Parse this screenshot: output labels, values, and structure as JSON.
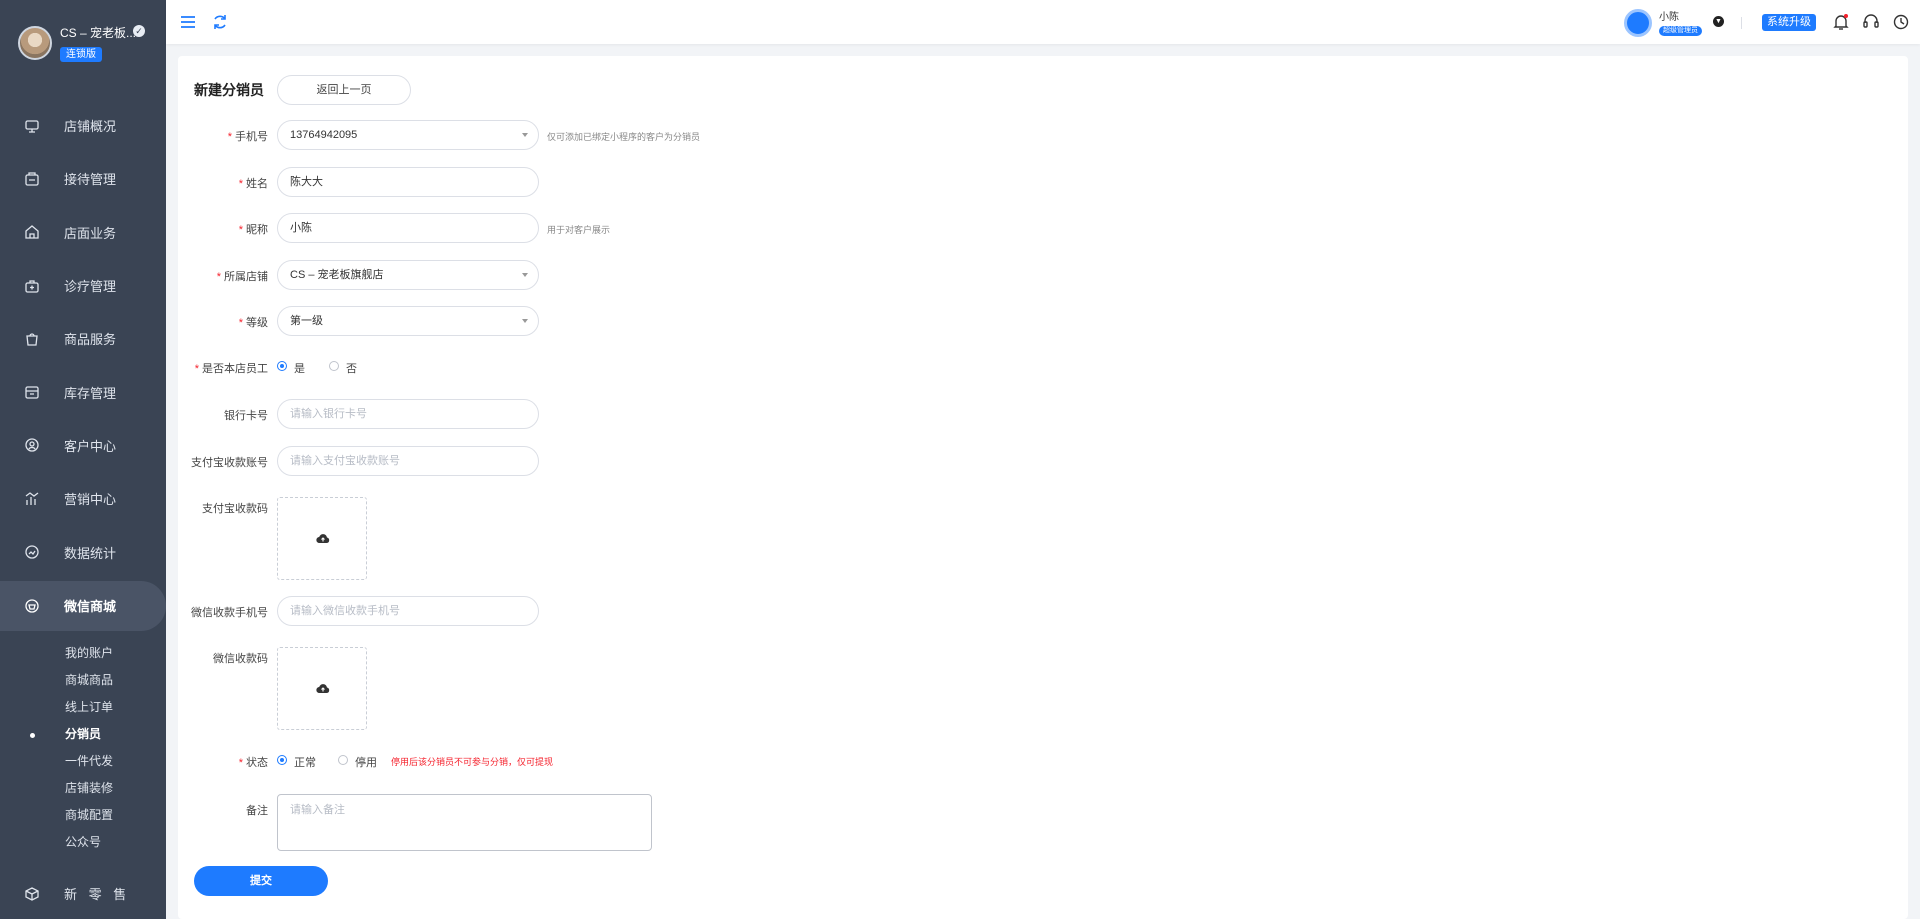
{
  "sidebar": {
    "shop_name": "CS – 宠老板...",
    "edition_badge": "连锁版",
    "menu": [
      {
        "label": "店铺概况",
        "icon": "monitor-icon"
      },
      {
        "label": "接待管理",
        "icon": "reception-icon"
      },
      {
        "label": "店面业务",
        "icon": "storefront-icon"
      },
      {
        "label": "诊疗管理",
        "icon": "medical-kit-icon"
      },
      {
        "label": "商品服务",
        "icon": "shopping-bag-icon"
      },
      {
        "label": "库存管理",
        "icon": "inventory-icon"
      },
      {
        "label": "客户中心",
        "icon": "customer-icon"
      },
      {
        "label": "营销中心",
        "icon": "marketing-chart-icon"
      },
      {
        "label": "数据统计",
        "icon": "statistics-icon"
      },
      {
        "label": "微信商城",
        "icon": "wechat-mall-icon",
        "active": true
      }
    ],
    "submenu": [
      {
        "label": "我的账户"
      },
      {
        "label": "商城商品"
      },
      {
        "label": "线上订单"
      },
      {
        "label": "分销员",
        "active": true
      },
      {
        "label": "一件代发"
      },
      {
        "label": "店铺装修"
      },
      {
        "label": "商城配置"
      },
      {
        "label": "公众号"
      }
    ],
    "retail_label": "新 零 售"
  },
  "topbar": {
    "user_name": "小陈",
    "role_badge": "超级管理员",
    "upgrade_label": "系统升级"
  },
  "form": {
    "title": "新建分销员",
    "back_label": "返回上一页",
    "phone_label": "手机号",
    "phone_value": "13764942095",
    "phone_hint": "仅可添加已绑定小程序的客户为分销员",
    "name_label": "姓名",
    "name_value": "陈大大",
    "nickname_label": "昵称",
    "nickname_value": "小陈",
    "nickname_hint": "用于对客户展示",
    "store_label": "所属店铺",
    "store_value": "CS – 宠老板旗舰店",
    "level_label": "等级",
    "level_value": "第一级",
    "is_staff_label": "是否本店员工",
    "is_staff_yes": "是",
    "is_staff_no": "否",
    "bank_label": "银行卡号",
    "bank_placeholder": "请输入银行卡号",
    "alipay_label": "支付宝收款账号",
    "alipay_placeholder": "请输入支付宝收款账号",
    "alipay_code_label": "支付宝收款码",
    "wechat_phone_label": "微信收款手机号",
    "wechat_phone_placeholder": "请输入微信收款手机号",
    "wechat_code_label": "微信收款码",
    "status_label": "状态",
    "status_normal": "正常",
    "status_disabled": "停用",
    "status_hint": "停用后该分销员不可参与分销，仅可提现",
    "remark_label": "备注",
    "remark_placeholder": "请输入备注",
    "submit_label": "提交"
  },
  "colors": {
    "sidebar_bg": "#3a4454",
    "primary": "#1e7bff",
    "required": "#f5222d"
  }
}
